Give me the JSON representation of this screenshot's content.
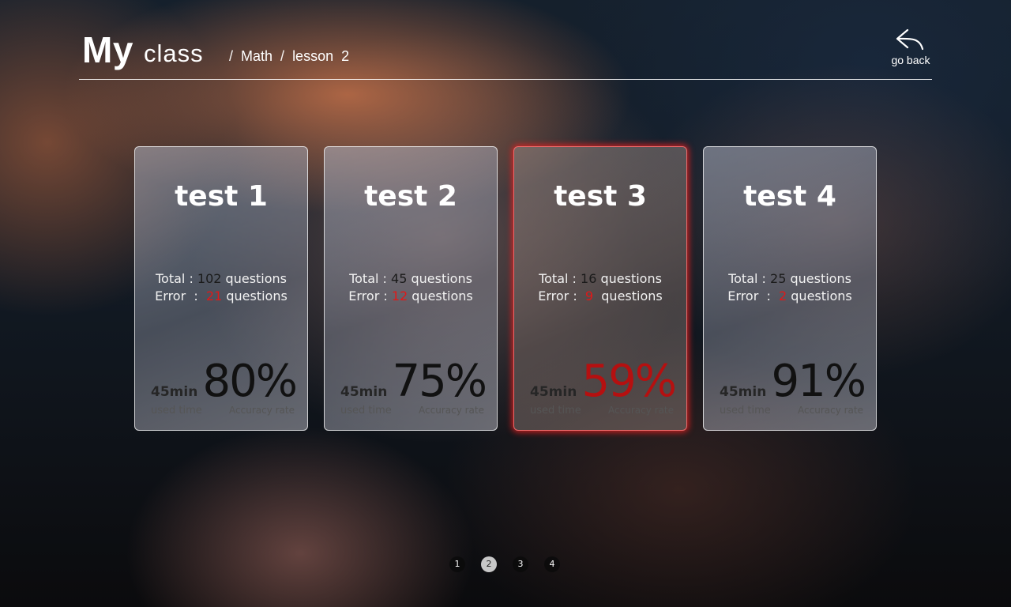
{
  "header": {
    "title_bold": "My",
    "title_rest": "class",
    "breadcrumb": {
      "sep1": "/",
      "subject": "Math",
      "sep2": "/",
      "lesson": "lesson  2"
    },
    "go_back": {
      "label": "go back",
      "icon": "return-arrow-icon"
    }
  },
  "colors": {
    "accent_error": "#e01818",
    "active_glow": "#e61e1e",
    "low_score": "#b51010"
  },
  "cards": [
    {
      "title": "test 1",
      "total_prefix": "Total : ",
      "total": "102",
      "total_suffix": " questions",
      "error_prefix": "Error  :  ",
      "errors": "21",
      "error_suffix": " questions",
      "time": "45min",
      "time_label": "used time",
      "rate": "80%",
      "rate_label": "Accuracy rate",
      "active": false
    },
    {
      "title": "test 2",
      "total_prefix": "Total : ",
      "total": "45",
      "total_suffix": " questions",
      "error_prefix": "Error : ",
      "errors": "12",
      "error_suffix": " questions",
      "time": "45min",
      "time_label": "used time",
      "rate": "75%",
      "rate_label": "Accuracy rate",
      "active": false
    },
    {
      "title": "test 3",
      "total_prefix": "Total : ",
      "total": "16",
      "total_suffix": " questions",
      "error_prefix": "Error :  ",
      "errors": "9",
      "error_suffix": "  questions",
      "time": "45min",
      "time_label": "used time",
      "rate": "59%",
      "rate_label": "Accuracy rate",
      "active": true
    },
    {
      "title": "test 4",
      "total_prefix": "Total : ",
      "total": "25",
      "total_suffix": " questions",
      "error_prefix": "Error  :  ",
      "errors": "2",
      "error_suffix": " questions",
      "time": "45min",
      "time_label": "used time",
      "rate": "91%",
      "rate_label": "Accuracy rate",
      "active": false
    }
  ],
  "pagination": {
    "pages": [
      "1",
      "2",
      "3",
      "4"
    ],
    "current": "2"
  }
}
